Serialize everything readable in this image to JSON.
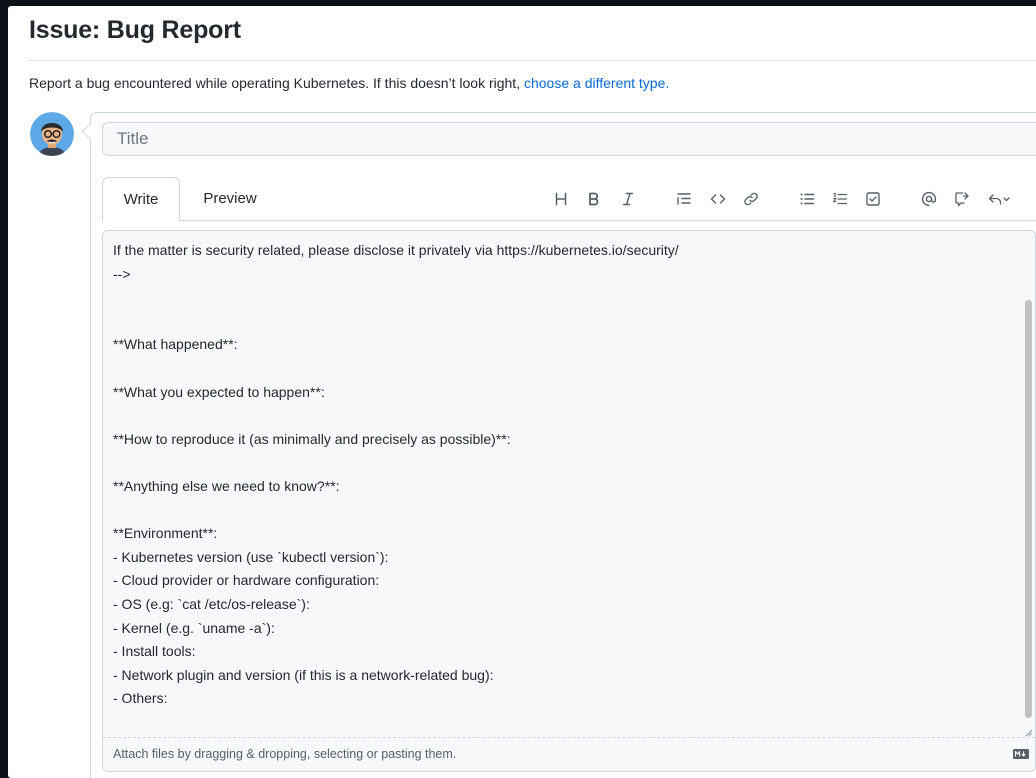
{
  "page": {
    "title": "Issue: Bug Report",
    "subtitle_text": "Report a bug encountered while operating Kubernetes. If this doesn’t look right, ",
    "subtitle_link": "choose a different type."
  },
  "form": {
    "title_placeholder": "Title",
    "tabs": [
      "Write",
      "Preview"
    ],
    "toolbar_icons": [
      "heading-icon",
      "bold-icon",
      "italic-icon",
      "quote-icon",
      "code-icon",
      "link-icon",
      "unordered-list-icon",
      "ordered-list-icon",
      "task-list-icon",
      "mention-icon",
      "reference-icon",
      "reply-icon"
    ],
    "body_lines": [
      "If the matter is security related, please disclose it privately via https://kubernetes.io/security/",
      "-->",
      "",
      "",
      "**What happened**:",
      "",
      "**What you expected to happen**:",
      "",
      "**How to reproduce it (as minimally and precisely as possible)**:",
      "",
      "**Anything else we need to know?**:",
      "",
      "**Environment**:",
      "- Kubernetes version (use `kubectl version`):",
      "- Cloud provider or hardware configuration:",
      "- OS (e.g: `cat /etc/os-release`):",
      "- Kernel (e.g. `uname -a`):",
      "- Install tools:",
      "- Network plugin and version (if this is a network-related bug):",
      "- Others:"
    ],
    "attach_text": "Attach files by dragging & dropping, selecting or pasting them.",
    "markdown_badge": "MD"
  },
  "colors": {
    "link": "#0969da",
    "background": "#0d1117"
  }
}
